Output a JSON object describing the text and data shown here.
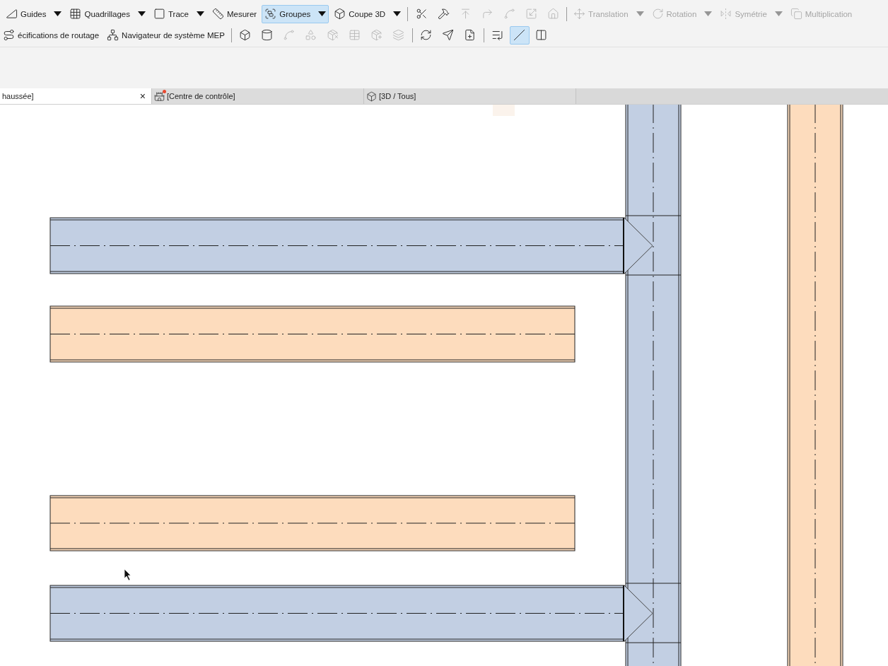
{
  "toolbar": {
    "rows": [
      {
        "items": [
          {
            "kind": "tool",
            "label": "Guides",
            "dropdown": true,
            "selected": false,
            "disabled": false
          },
          {
            "kind": "tool",
            "label": "Quadrillages",
            "dropdown": true,
            "selected": false,
            "disabled": false
          },
          {
            "kind": "tool",
            "label": "Trace",
            "dropdown": true,
            "selected": false,
            "disabled": false
          },
          {
            "kind": "tool",
            "label": "Mesurer",
            "dropdown": false,
            "selected": false,
            "disabled": false
          },
          {
            "kind": "tool",
            "label": "Groupes",
            "dropdown": true,
            "selected": true,
            "disabled": false
          },
          {
            "kind": "tool",
            "label": "Coupe 3D",
            "dropdown": true,
            "selected": false,
            "disabled": false
          },
          {
            "kind": "separator"
          },
          {
            "kind": "icon",
            "selected": false,
            "disabled": false
          },
          {
            "kind": "icon",
            "selected": false,
            "disabled": false
          },
          {
            "kind": "icon",
            "selected": false,
            "disabled": true
          },
          {
            "kind": "icon",
            "selected": false,
            "disabled": true
          },
          {
            "kind": "icon",
            "selected": false,
            "disabled": true
          },
          {
            "kind": "icon",
            "selected": false,
            "disabled": true
          },
          {
            "kind": "icon",
            "selected": false,
            "disabled": true
          },
          {
            "kind": "separator"
          },
          {
            "kind": "tool",
            "label": "Translation",
            "dropdown": true,
            "selected": false,
            "disabled": true
          },
          {
            "kind": "tool",
            "label": "Rotation",
            "dropdown": true,
            "selected": false,
            "disabled": true
          },
          {
            "kind": "tool",
            "label": "Symétrie",
            "dropdown": true,
            "selected": false,
            "disabled": true
          },
          {
            "kind": "tool",
            "label": "Multiplication",
            "dropdown": false,
            "selected": false,
            "disabled": true
          }
        ]
      },
      {
        "items": [
          {
            "kind": "tool",
            "label": "écifications de routage",
            "dropdown": false,
            "selected": false,
            "disabled": false
          },
          {
            "kind": "tool",
            "label": "Navigateur de système MEP",
            "dropdown": false,
            "selected": false,
            "disabled": false
          },
          {
            "kind": "separator"
          },
          {
            "kind": "icon",
            "selected": false,
            "disabled": false
          },
          {
            "kind": "icon",
            "selected": false,
            "disabled": false
          },
          {
            "kind": "icon",
            "selected": false,
            "disabled": true
          },
          {
            "kind": "icon",
            "selected": false,
            "disabled": true
          },
          {
            "kind": "icon",
            "selected": false,
            "disabled": true
          },
          {
            "kind": "icon",
            "selected": false,
            "disabled": true
          },
          {
            "kind": "icon",
            "selected": false,
            "disabled": true
          },
          {
            "kind": "icon",
            "selected": false,
            "disabled": true
          },
          {
            "kind": "separator"
          },
          {
            "kind": "icon",
            "selected": false,
            "disabled": false
          },
          {
            "kind": "icon",
            "selected": false,
            "disabled": false
          },
          {
            "kind": "icon",
            "selected": false,
            "disabled": false
          },
          {
            "kind": "separator"
          },
          {
            "kind": "icon",
            "selected": false,
            "disabled": false
          },
          {
            "kind": "icon",
            "selected": true,
            "disabled": false
          },
          {
            "kind": "icon",
            "selected": false,
            "disabled": false
          }
        ]
      }
    ]
  },
  "tabs": [
    {
      "label": "haussée]",
      "selected": true,
      "close": "×",
      "notification": false
    },
    {
      "label": "[Centre de contrôle]",
      "selected": false,
      "notification": true
    },
    {
      "label": "[3D / Tous]",
      "selected": false,
      "notification": false
    }
  ],
  "canvas": {
    "ducts": [
      {
        "kind": "vertical",
        "color": "#c2cfe3",
        "arrow": false
      },
      {
        "kind": "vertical",
        "color": "#fddcbd",
        "arrow": false
      },
      {
        "kind": "horizontal",
        "color": "#c2cfe3",
        "arrow": true
      },
      {
        "kind": "horizontal",
        "color": "#fddcbd",
        "arrow": false
      },
      {
        "kind": "horizontal",
        "color": "#fddcbd",
        "arrow": false
      },
      {
        "kind": "horizontal",
        "color": "#c2cfe3",
        "arrow": true
      }
    ]
  }
}
